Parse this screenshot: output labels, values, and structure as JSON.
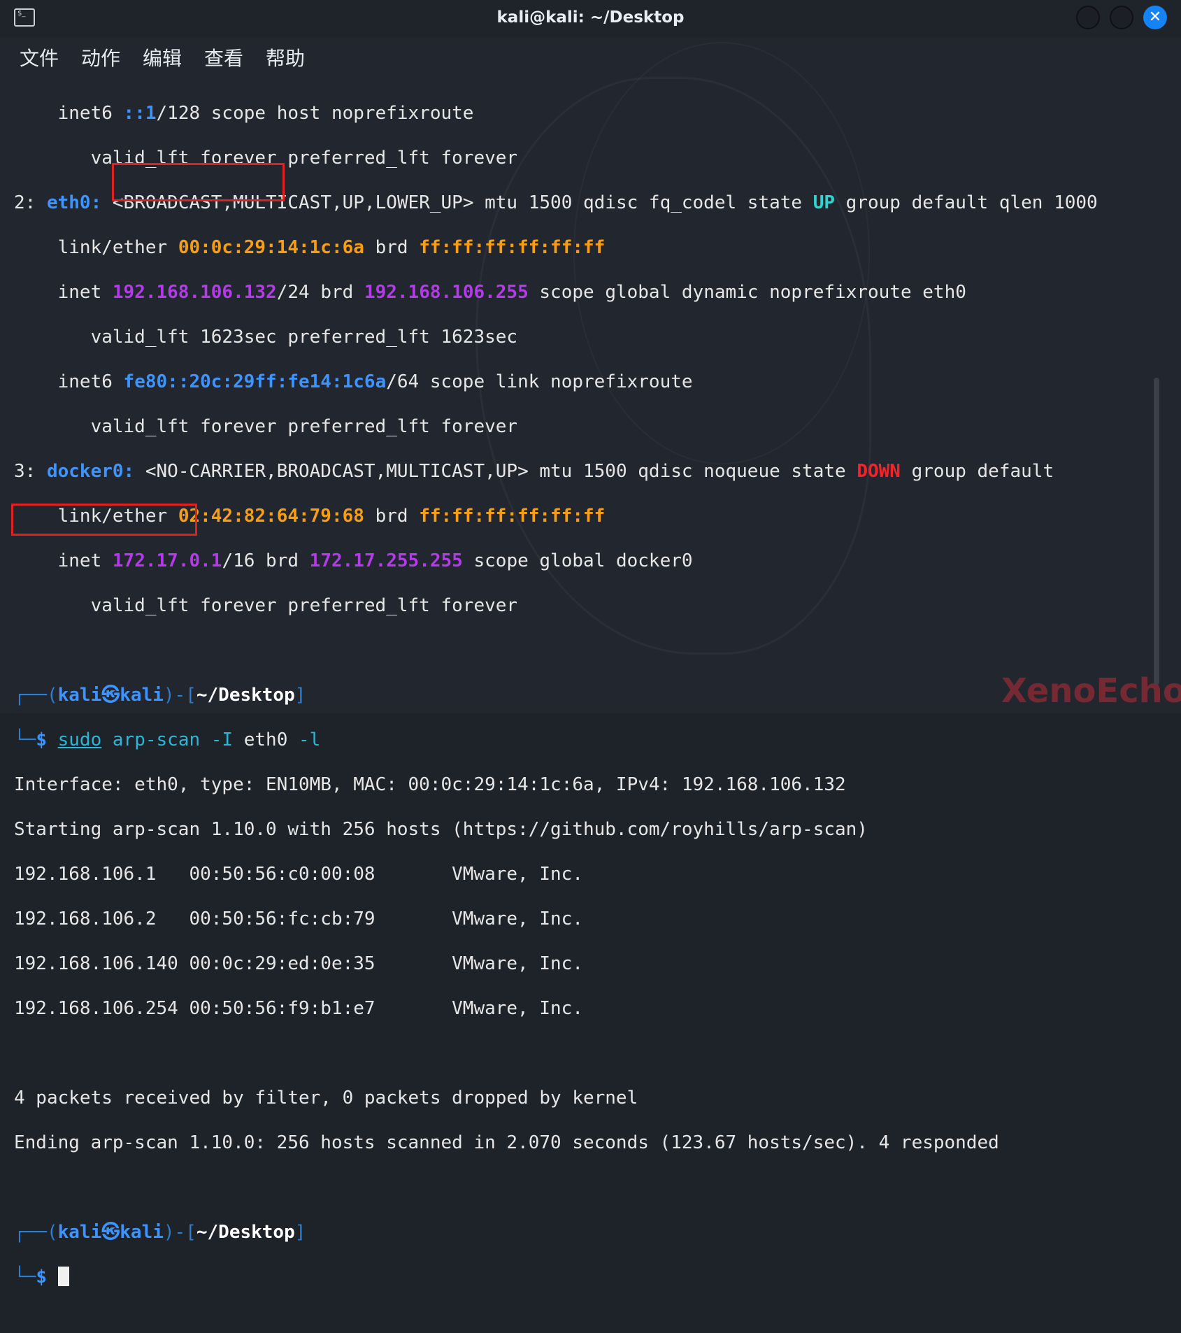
{
  "window": {
    "title": "kali@kali: ~/Desktop"
  },
  "menu": {
    "items": [
      "文件",
      "动作",
      "编辑",
      "查看",
      "帮助"
    ]
  },
  "terminal": {
    "l1": {
      "a": "    inet6 ",
      "b": "::1",
      "c": "/128 scope host noprefixroute"
    },
    "l2": "       valid_lft forever preferred_lft forever",
    "l3": {
      "a": "2: ",
      "b": "eth0:",
      "c": " <BROADCAST,MULTICAST,UP,LOWER_UP> mtu 1500 qdisc fq_codel state ",
      "d": "UP",
      "e": " group default qlen 1000"
    },
    "l4": {
      "a": "    link/ether ",
      "b": "00:0c:29:14:1c:6a",
      "c": " brd ",
      "d": "ff:ff:ff:ff:ff:ff"
    },
    "l5": {
      "a": "    inet ",
      "b": "192.168.106.132",
      "c": "/24 brd ",
      "d": "192.168.106.255",
      "e": " scope global dynamic noprefixroute eth0"
    },
    "l6": "       valid_lft 1623sec preferred_lft 1623sec",
    "l7": {
      "a": "    inet6 ",
      "b": "fe80::20c:29ff:fe14:1c6a",
      "c": "/64 scope link noprefixroute"
    },
    "l8": "       valid_lft forever preferred_lft forever",
    "l9": {
      "a": "3: ",
      "b": "docker0:",
      "c": " <NO-CARRIER,BROADCAST,MULTICAST,UP> mtu 1500 qdisc noqueue state ",
      "d": "DOWN",
      "e": " group default"
    },
    "l10": {
      "a": "    link/ether ",
      "b": "02:42:82:64:79:68",
      "c": " brd ",
      "d": "ff:ff:ff:ff:ff:ff"
    },
    "l11": {
      "a": "    inet ",
      "b": "172.17.0.1",
      "c": "/16 brd ",
      "d": "172.17.255.255",
      "e": " scope global docker0"
    },
    "l12": "       valid_lft forever preferred_lft forever",
    "prompt": {
      "corner_top": "┌──(",
      "user": "kali",
      "at": "㉿",
      "host": "kali",
      "mid": ")-[",
      "path": "~/Desktop",
      "end": "]",
      "corner_bottom": "└─",
      "dollar": "$"
    },
    "cmd": {
      "sudo": "sudo",
      "rest": " arp-scan -I ",
      "iface": "eth0",
      "flag": " -l"
    },
    "out1": "Interface: eth0, type: EN10MB, MAC: 00:0c:29:14:1c:6a, IPv4: 192.168.106.132",
    "out2": "Starting arp-scan 1.10.0 with 256 hosts (https://github.com/royhills/arp-scan)",
    "rows": [
      "192.168.106.1   00:50:56:c0:00:08       VMware, Inc.",
      "192.168.106.2   00:50:56:fc:cb:79       VMware, Inc.",
      "192.168.106.140 00:0c:29:ed:0e:35       VMware, Inc.",
      "192.168.106.254 00:50:56:f9:b1:e7       VMware, Inc."
    ],
    "out3": "4 packets received by filter, 0 packets dropped by kernel",
    "out4": "Ending arp-scan 1.10.0: 256 hosts scanned in 2.070 seconds (123.67 hosts/sec). 4 responded"
  },
  "watermark": "XenoEcho",
  "colors": {
    "blue": "#3e94ff",
    "orange": "#f89e12",
    "purple": "#b33be8",
    "red": "#f2242b",
    "green": "#2fd6d0",
    "highlight_box": "#e0211f"
  }
}
